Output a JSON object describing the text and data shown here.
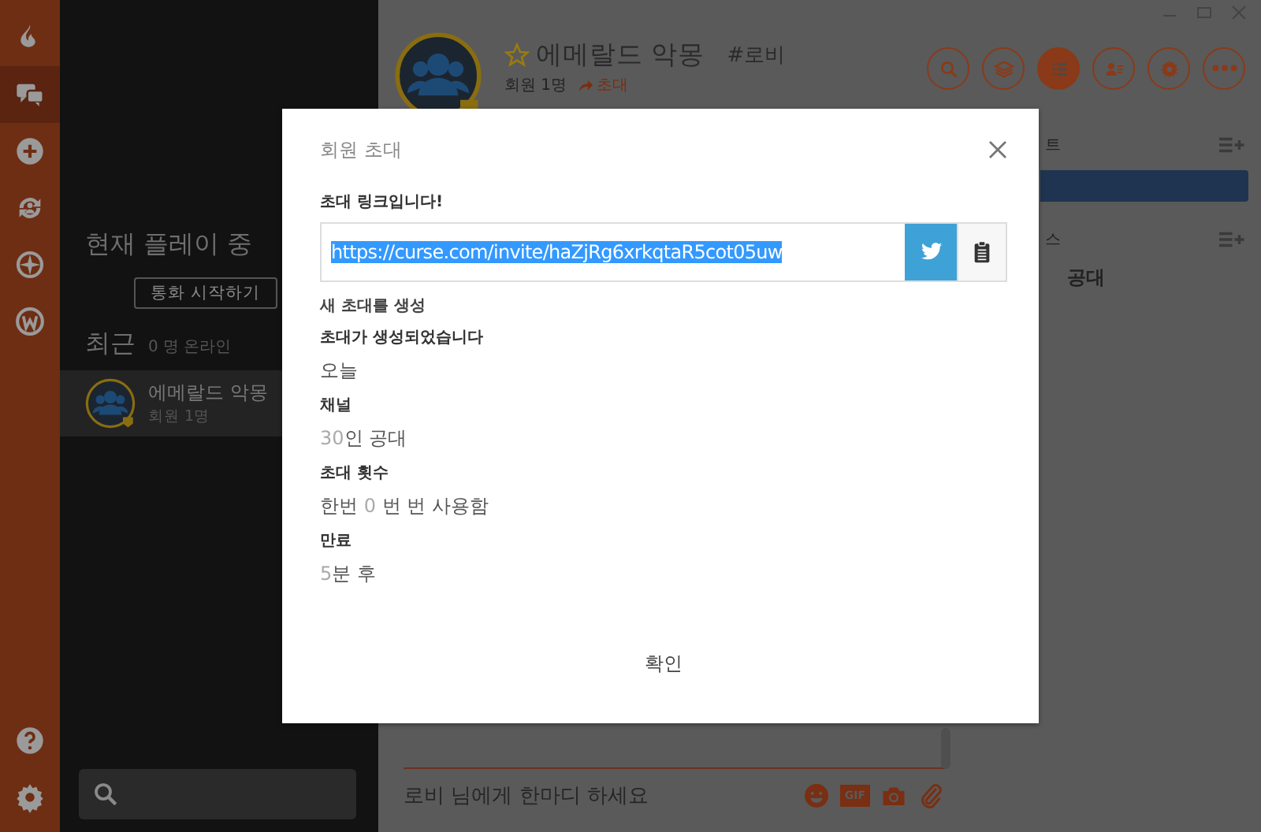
{
  "rail": {
    "items": [
      {
        "kind": "flame",
        "selected": false
      },
      {
        "kind": "chat",
        "selected": true
      },
      {
        "kind": "add",
        "selected": false
      },
      {
        "kind": "sync",
        "selected": false
      },
      {
        "kind": "compass",
        "selected": false
      },
      {
        "kind": "w",
        "selected": false
      }
    ],
    "bottom": [
      {
        "kind": "help"
      },
      {
        "kind": "settings"
      }
    ]
  },
  "sidebar": {
    "now_playing_title": "현재 플레이 중",
    "call_button": "통화 시작하기",
    "recent_title": "최근",
    "online_count": "0 명 온라인",
    "recent": [
      {
        "name": "에메랄드 악몽",
        "members": "회원 1명",
        "selected": true
      }
    ]
  },
  "header": {
    "name": "에메랄드 악몽",
    "favorite": false,
    "channel": "#로비",
    "members": "회원 1명",
    "invite": "초대",
    "toolbar": [
      {
        "kind": "search",
        "selected": false
      },
      {
        "kind": "layers",
        "selected": false
      },
      {
        "kind": "list",
        "selected": true
      },
      {
        "kind": "contact",
        "selected": false
      },
      {
        "kind": "settings",
        "selected": false
      },
      {
        "kind": "more",
        "selected": false
      }
    ]
  },
  "panel": {
    "sections": [
      {
        "title": "트",
        "highlight": true
      },
      {
        "title": "스",
        "highlight": false,
        "items": [
          "공대"
        ]
      }
    ]
  },
  "composer": {
    "placeholder": "로비 님에게 한마디 하세요",
    "tools": [
      {
        "kind": "emoji"
      },
      {
        "kind": "gif",
        "label": "GIF"
      },
      {
        "kind": "camera"
      },
      {
        "kind": "attach"
      }
    ]
  },
  "modal": {
    "title": "회원 초대",
    "link_label": "초대 링크입니다!",
    "link": "https://curse.com/invite/haZjRg6xrkqtaR5cot05uw",
    "link_selected": true,
    "create_link": "새 초대를 생성",
    "fields": [
      {
        "label": "초대가 생성되었습니다",
        "value": [
          {
            "text": "오늘",
            "dim": false
          }
        ]
      },
      {
        "label": "채널",
        "value": [
          {
            "text": "30",
            "dim": true
          },
          {
            "text": "인 공대",
            "dim": false
          }
        ]
      },
      {
        "label": "초대 횟수",
        "value": [
          {
            "text": "한번 ",
            "dim": false
          },
          {
            "text": "0",
            "dim": true
          },
          {
            "text": " 번 번 사용함",
            "dim": false
          }
        ]
      },
      {
        "label": "만료",
        "value": [
          {
            "text": "5",
            "dim": true
          },
          {
            "text": "분 후",
            "dim": false
          }
        ]
      }
    ],
    "ok": "확인"
  }
}
